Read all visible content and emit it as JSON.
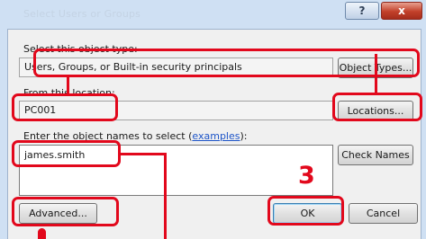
{
  "dialog": {
    "title": "Select Users or Groups",
    "help_glyph": "?",
    "close_glyph": "x"
  },
  "object_type": {
    "label": "Select this object type:",
    "value": "Users, Groups, or Built-in security principals",
    "button": "Object Types..."
  },
  "location": {
    "label": "From this location:",
    "value": "PC001",
    "button": "Locations..."
  },
  "names": {
    "label_prefix": "Enter the object names to select (",
    "label_link": "examples",
    "label_suffix": "):",
    "value": "james.smith",
    "check_button": "Check Names"
  },
  "footer": {
    "advanced_button": "Advanced...",
    "ok_button": "OK",
    "cancel_button": "Cancel"
  },
  "annotation": {
    "step_number": "3",
    "highlight_color": "#e2081c"
  }
}
